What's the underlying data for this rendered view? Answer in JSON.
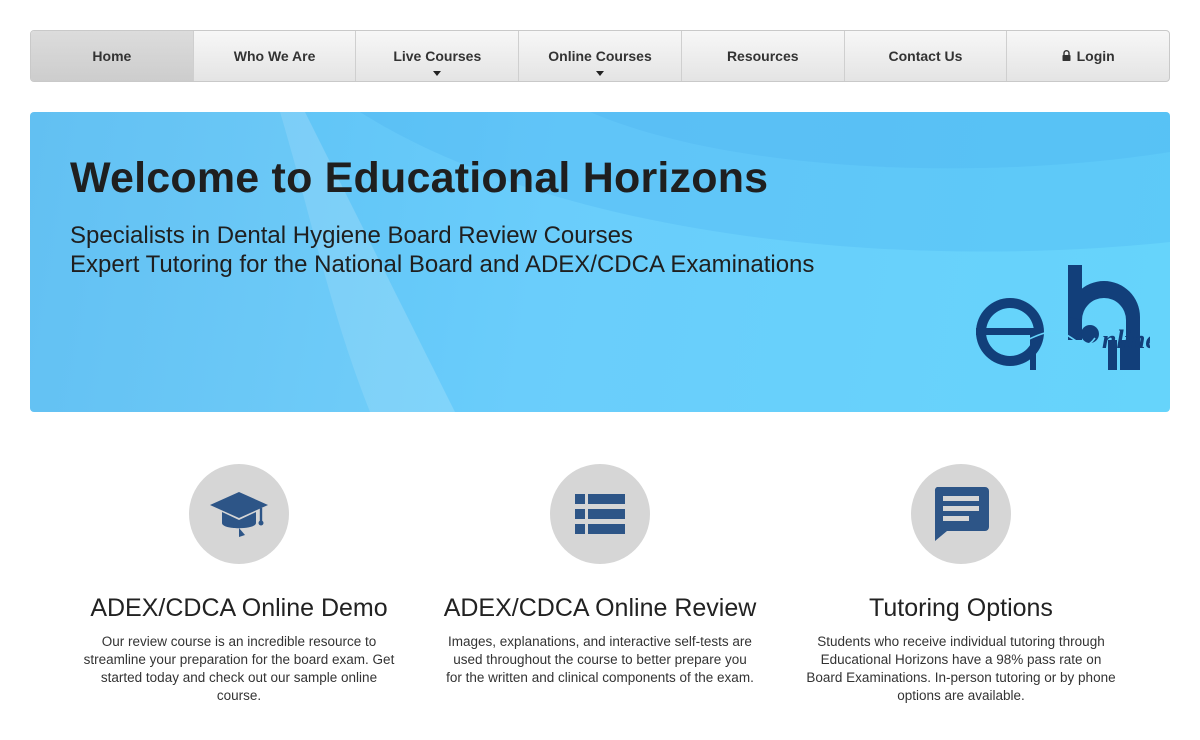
{
  "nav": {
    "items": [
      {
        "label": "Home"
      },
      {
        "label": "Who We Are"
      },
      {
        "label": "Live Courses"
      },
      {
        "label": "Online Courses"
      },
      {
        "label": "Resources"
      },
      {
        "label": "Contact Us"
      },
      {
        "label": "Login",
        "icon": "lock-icon"
      }
    ]
  },
  "hero": {
    "title": "Welcome to Educational Horizons",
    "subtitle_1": "Specialists in Dental Hygiene Board Review Courses",
    "subtitle_2": "Expert Tutoring for the National Board and ADEX/CDCA Examinations",
    "logo_text": "nline",
    "logo_color": "#123f7a"
  },
  "features": [
    {
      "icon": "graduation-cap-icon",
      "title": "ADEX/CDCA Online Demo",
      "text": "Our review course is an incredible resource to streamline your preparation for the board exam. Get started today and check out our sample online course."
    },
    {
      "icon": "list-icon",
      "title": "ADEX/CDCA Online Review",
      "text": "Images, explanations, and interactive self-tests are used throughout the course to better prepare you for the written and clinical components of the exam."
    },
    {
      "icon": "chat-icon",
      "title": "Tutoring Options",
      "text": "Students who receive individual tutoring through Educational Horizons have a 98% pass rate on Board Examinations. In-person tutoring or by phone options are available."
    }
  ],
  "colors": {
    "icon_blue": "#2d5587",
    "circle_gray": "#d6d6d6",
    "hero_blue": "#66d4fb"
  }
}
